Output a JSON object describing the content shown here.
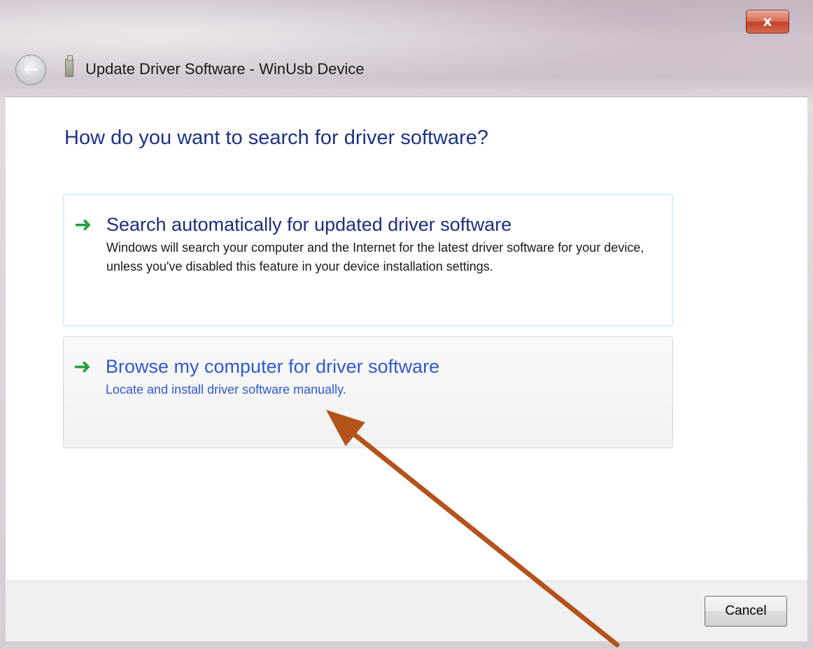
{
  "window": {
    "title": "Update Driver Software - WinUsb Device",
    "close_label": "x"
  },
  "nav": {
    "back_icon": "back-arrow-icon",
    "device_icon": "usb-device-icon"
  },
  "main": {
    "heading": "How do you want to search for driver software?",
    "options": [
      {
        "title": "Search automatically for updated driver software",
        "description": "Windows will search your computer and the Internet for the latest driver software for your device, unless you've disabled this feature in your device installation settings."
      },
      {
        "title": "Browse my computer for driver software",
        "description": "Locate and install driver software manually."
      }
    ]
  },
  "footer": {
    "cancel_label": "Cancel"
  },
  "colors": {
    "heading": "#1e3287",
    "link": "#2f59d3",
    "arrow": "#22a03a",
    "annotation": "#b4531a"
  }
}
